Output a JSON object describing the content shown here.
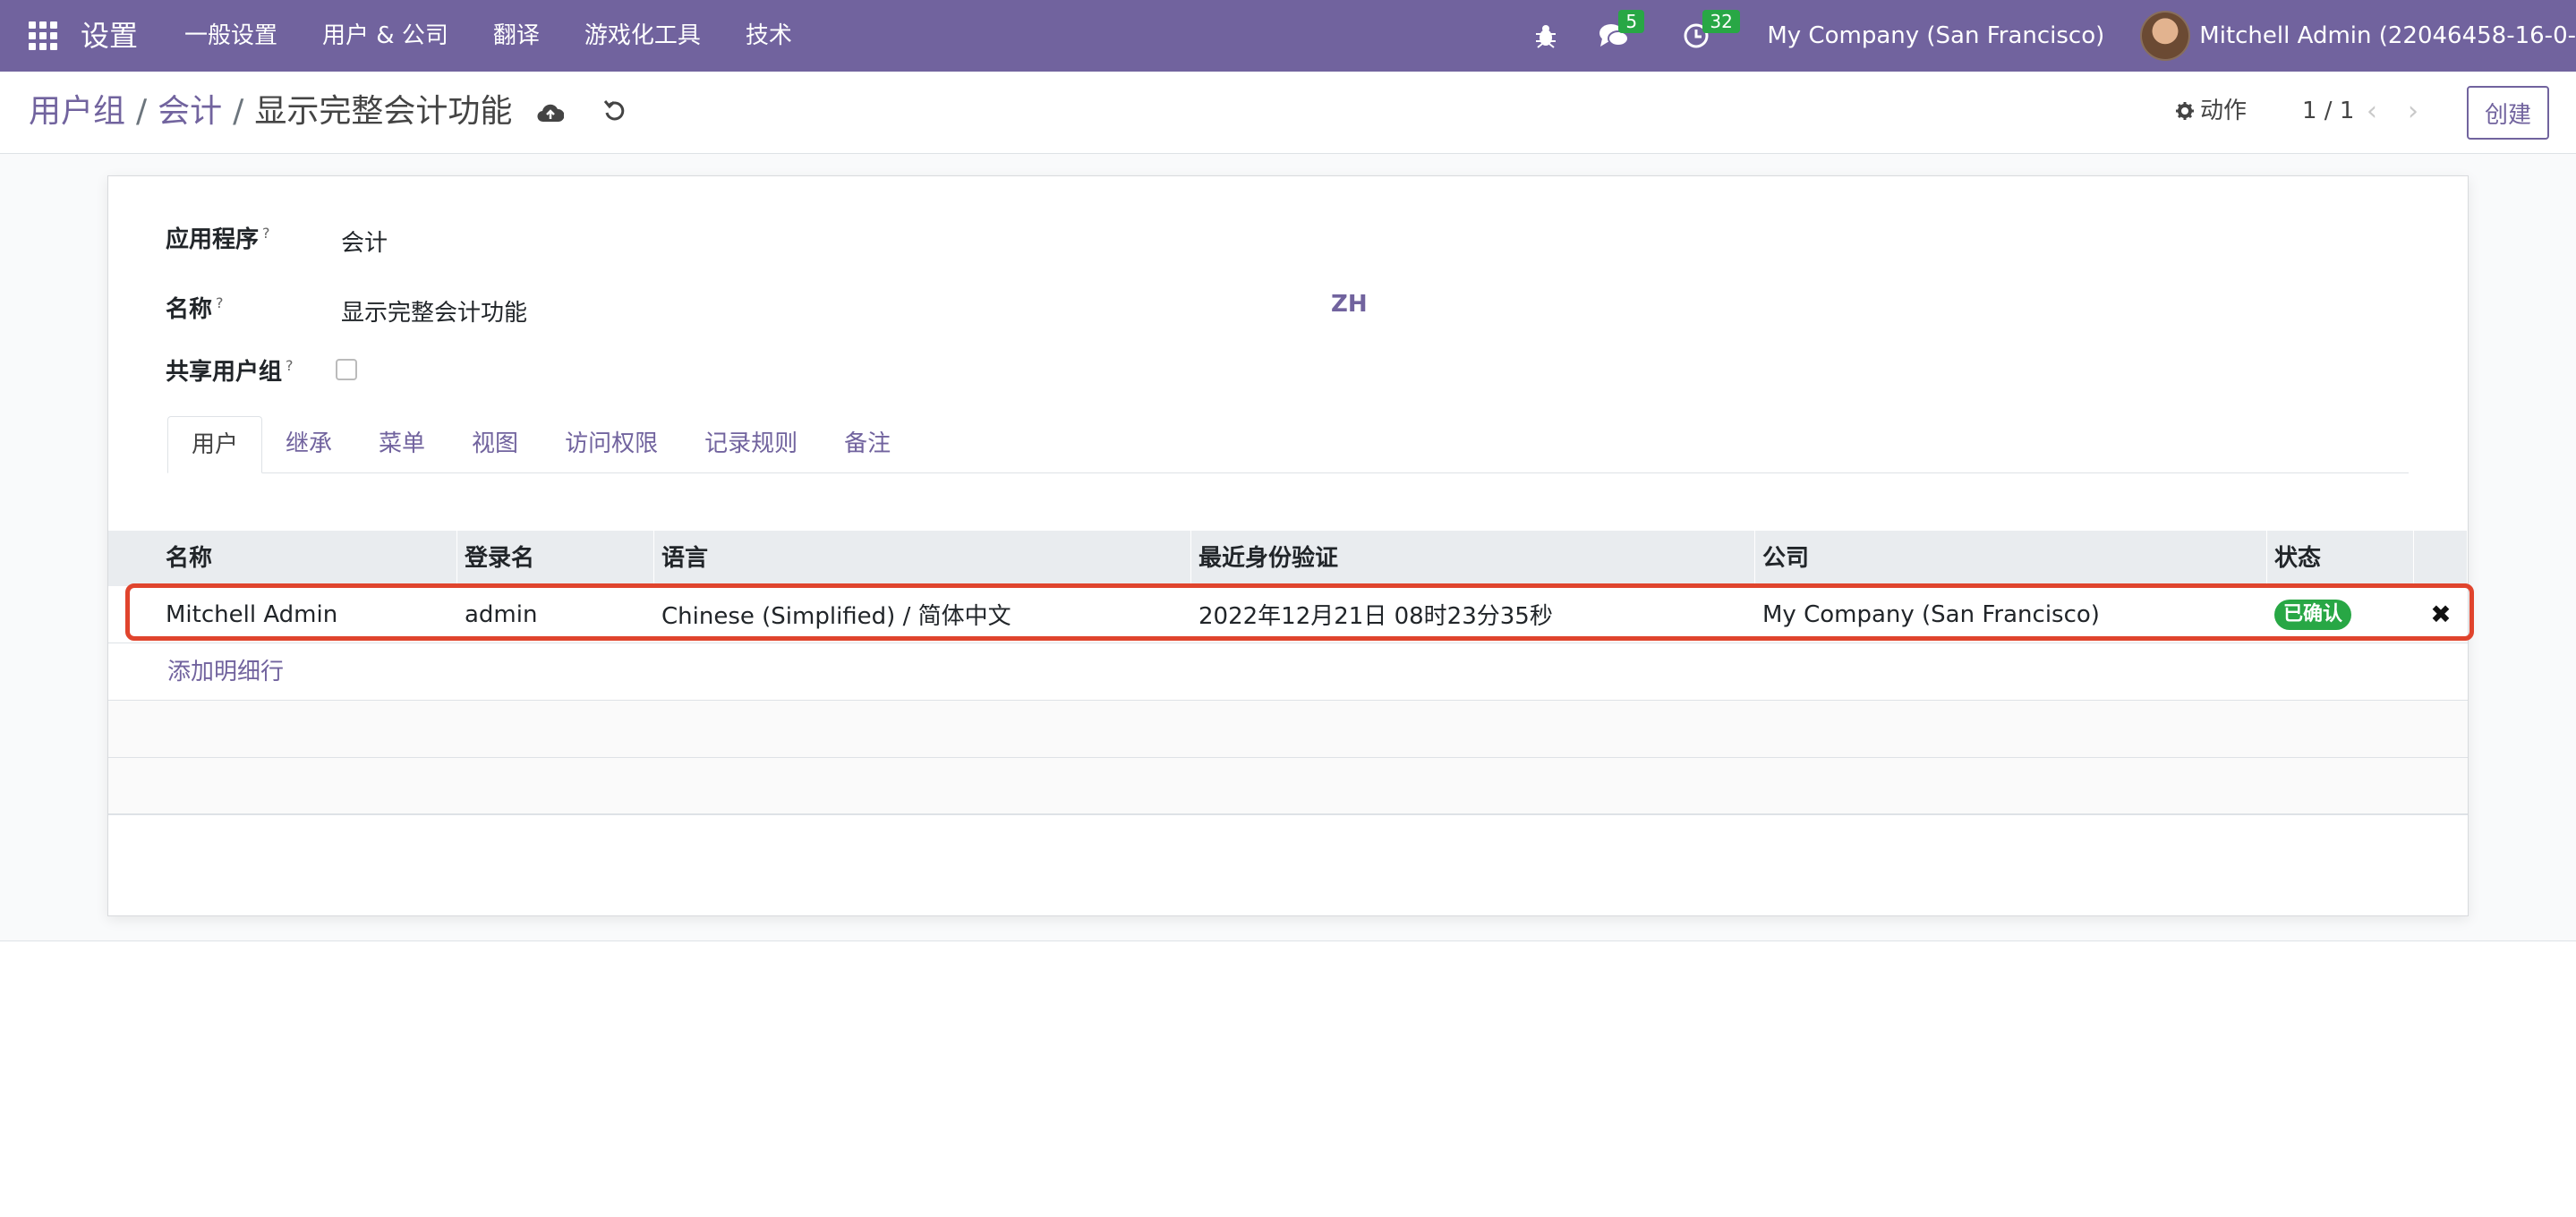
{
  "navbar": {
    "brand": "设置",
    "menu": [
      "一般设置",
      "用户 & 公司",
      "翻译",
      "游戏化工具",
      "技术"
    ],
    "messages_count": "5",
    "activities_count": "32",
    "company": "My Company (San Francisco)",
    "user": "Mitchell Admin (22046458-16-0-"
  },
  "control": {
    "breadcrumb": [
      "用户组",
      "会计",
      "显示完整会计功能"
    ],
    "action_label": "动作",
    "pager": "1 / 1",
    "create_label": "创建"
  },
  "form": {
    "app_label": "应用程序",
    "app_value": "会计",
    "name_label": "名称",
    "name_value": "显示完整会计功能",
    "lang_btn": "ZH",
    "share_label": "共享用户组",
    "help": "?"
  },
  "tabs": [
    "用户",
    "继承",
    "菜单",
    "视图",
    "访问权限",
    "记录规则",
    "备注"
  ],
  "table": {
    "headers": [
      "名称",
      "登录名",
      "语言",
      "最近身份验证",
      "公司",
      "状态"
    ],
    "rows": [
      {
        "name": "Mitchell Admin",
        "login": "admin",
        "lang": "Chinese (Simplified) / 简体中文",
        "last_auth": "2022年12月21日 08时23分35秒",
        "company": "My Company (San Francisco)",
        "status": "已确认"
      }
    ],
    "add_line": "添加明细行"
  },
  "colors": {
    "primary": "#71639e",
    "success": "#28a745",
    "highlight": "#e0442d"
  }
}
